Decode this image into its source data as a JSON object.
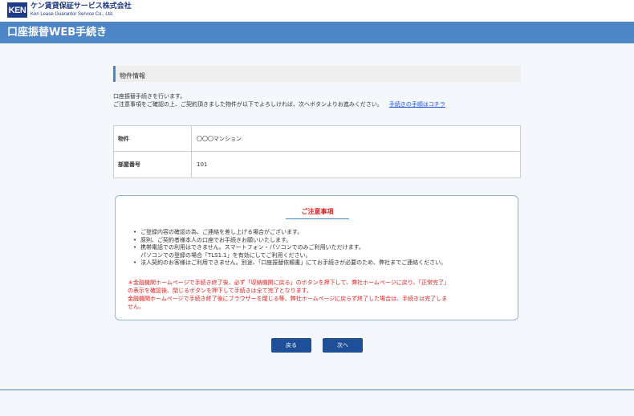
{
  "company": {
    "logo_text": "KEN",
    "name_jp": "ケン賃貸保証サービス株式会社",
    "name_en": "Ken Lease Guarantor Service Co., Ltd."
  },
  "page": {
    "title": "口座振替WEB手続き"
  },
  "property_section": {
    "heading": "物件情報",
    "intro_line1": "口座振替手続きを行います。",
    "intro_line2": "ご注意事項をご確認の上、ご契約頂きました物件が以下でよろしければ、次へボタンよりお進みください。",
    "procedure_link": "手続きの手順はコチラ",
    "rows": [
      {
        "label": "物件",
        "value": "〇〇〇マンション"
      },
      {
        "label": "部屋番号",
        "value": "101"
      }
    ]
  },
  "notice": {
    "title": "ご注意事項",
    "items": [
      {
        "text": "ご登録内容の確認の為、ご連絡を差し上げる場合がございます。",
        "sub": ""
      },
      {
        "text": "原則、ご契約者様本人の口座でお手続きお願いいたします。",
        "sub": ""
      },
      {
        "text": "携帯電話での利用はできません。スマートフォン・パソコンでのみご利用いただけます。",
        "sub": "パソコンでの登録の場合「TLS1.1」を有効にしてご利用ください。"
      },
      {
        "text": "法人契約のお客様はご利用できません。別途、「口座振替依頼書」にてお手続きが必要のため、弊社までご連絡ください。",
        "sub": ""
      }
    ],
    "warning_line1": "＊金融機関ホームページで手続き終了後、必ず「収納機関に戻る」のボタンを押下して、弊社ホームページに戻り、「正常完了」",
    "warning_line2": "の表示を確認後、閉じるボタンを押下して手続きは全て完了となります。",
    "warning_line3": "金融機関ホームページで手続き終了後にブラウザーを閉じる等、弊社ホームページに戻らず終了した場合は、手続きは完了しま",
    "warning_line4": "せん。"
  },
  "buttons": {
    "back": "戻る",
    "next": "次へ"
  },
  "colors": {
    "header_blue": "#4f86c8",
    "button_navy": "#1f4f99",
    "warning_red": "#e02020",
    "link_blue": "#1a4fd6"
  }
}
